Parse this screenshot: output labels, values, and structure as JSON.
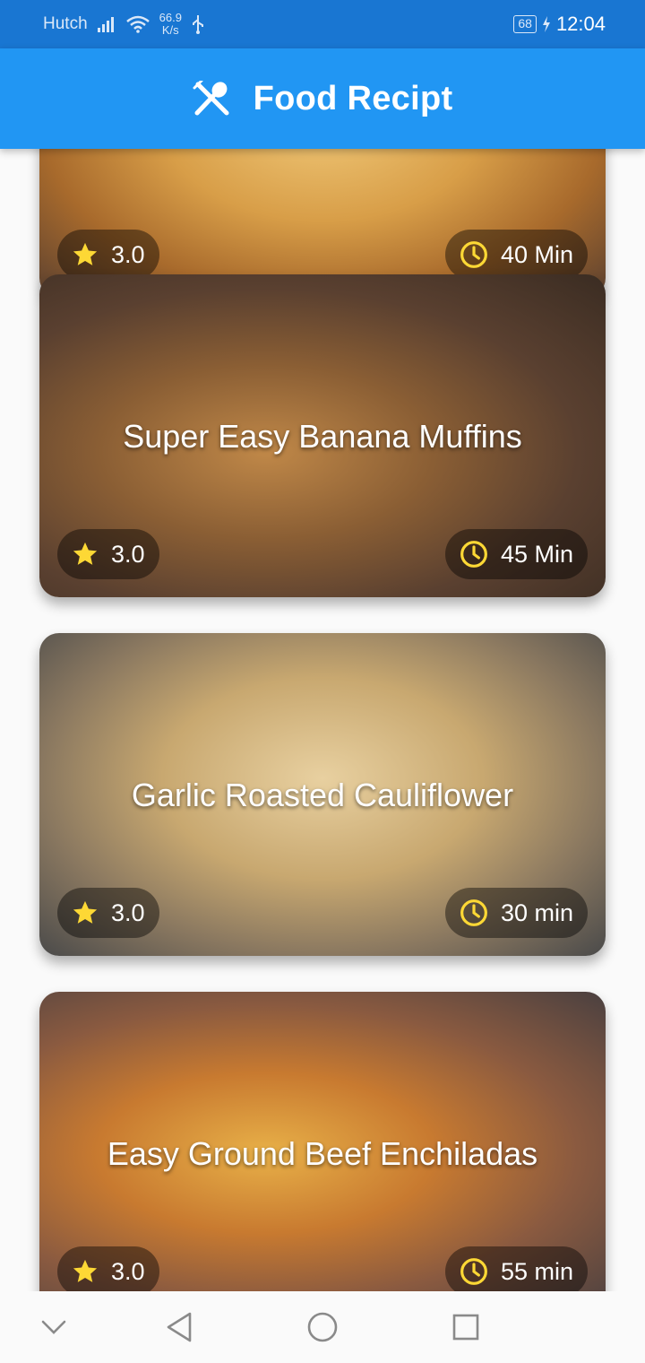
{
  "status_bar": {
    "carrier": "Hutch",
    "speed_value": "66.9",
    "speed_unit": "K/s",
    "battery": "68",
    "time": "12:04"
  },
  "app_bar": {
    "title": "Food Recipt",
    "icon": "utensils-icon"
  },
  "colors": {
    "status_bar": "#1976d2",
    "app_bar": "#2196f3",
    "star": "#fdd835",
    "clock": "#fdd835"
  },
  "recipes": [
    {
      "title": "",
      "rating": "3.0",
      "time": "40 Min"
    },
    {
      "title": "Super Easy Banana Muffins",
      "rating": "3.0",
      "time": "45 Min"
    },
    {
      "title": "Garlic Roasted Cauliflower",
      "rating": "3.0",
      "time": "30 min"
    },
    {
      "title": "Easy Ground Beef Enchiladas",
      "rating": "3.0",
      "time": "55 min"
    }
  ],
  "nav_bar": {
    "icons": [
      "chevron-down-icon",
      "back-icon",
      "home-icon",
      "recents-icon"
    ]
  }
}
